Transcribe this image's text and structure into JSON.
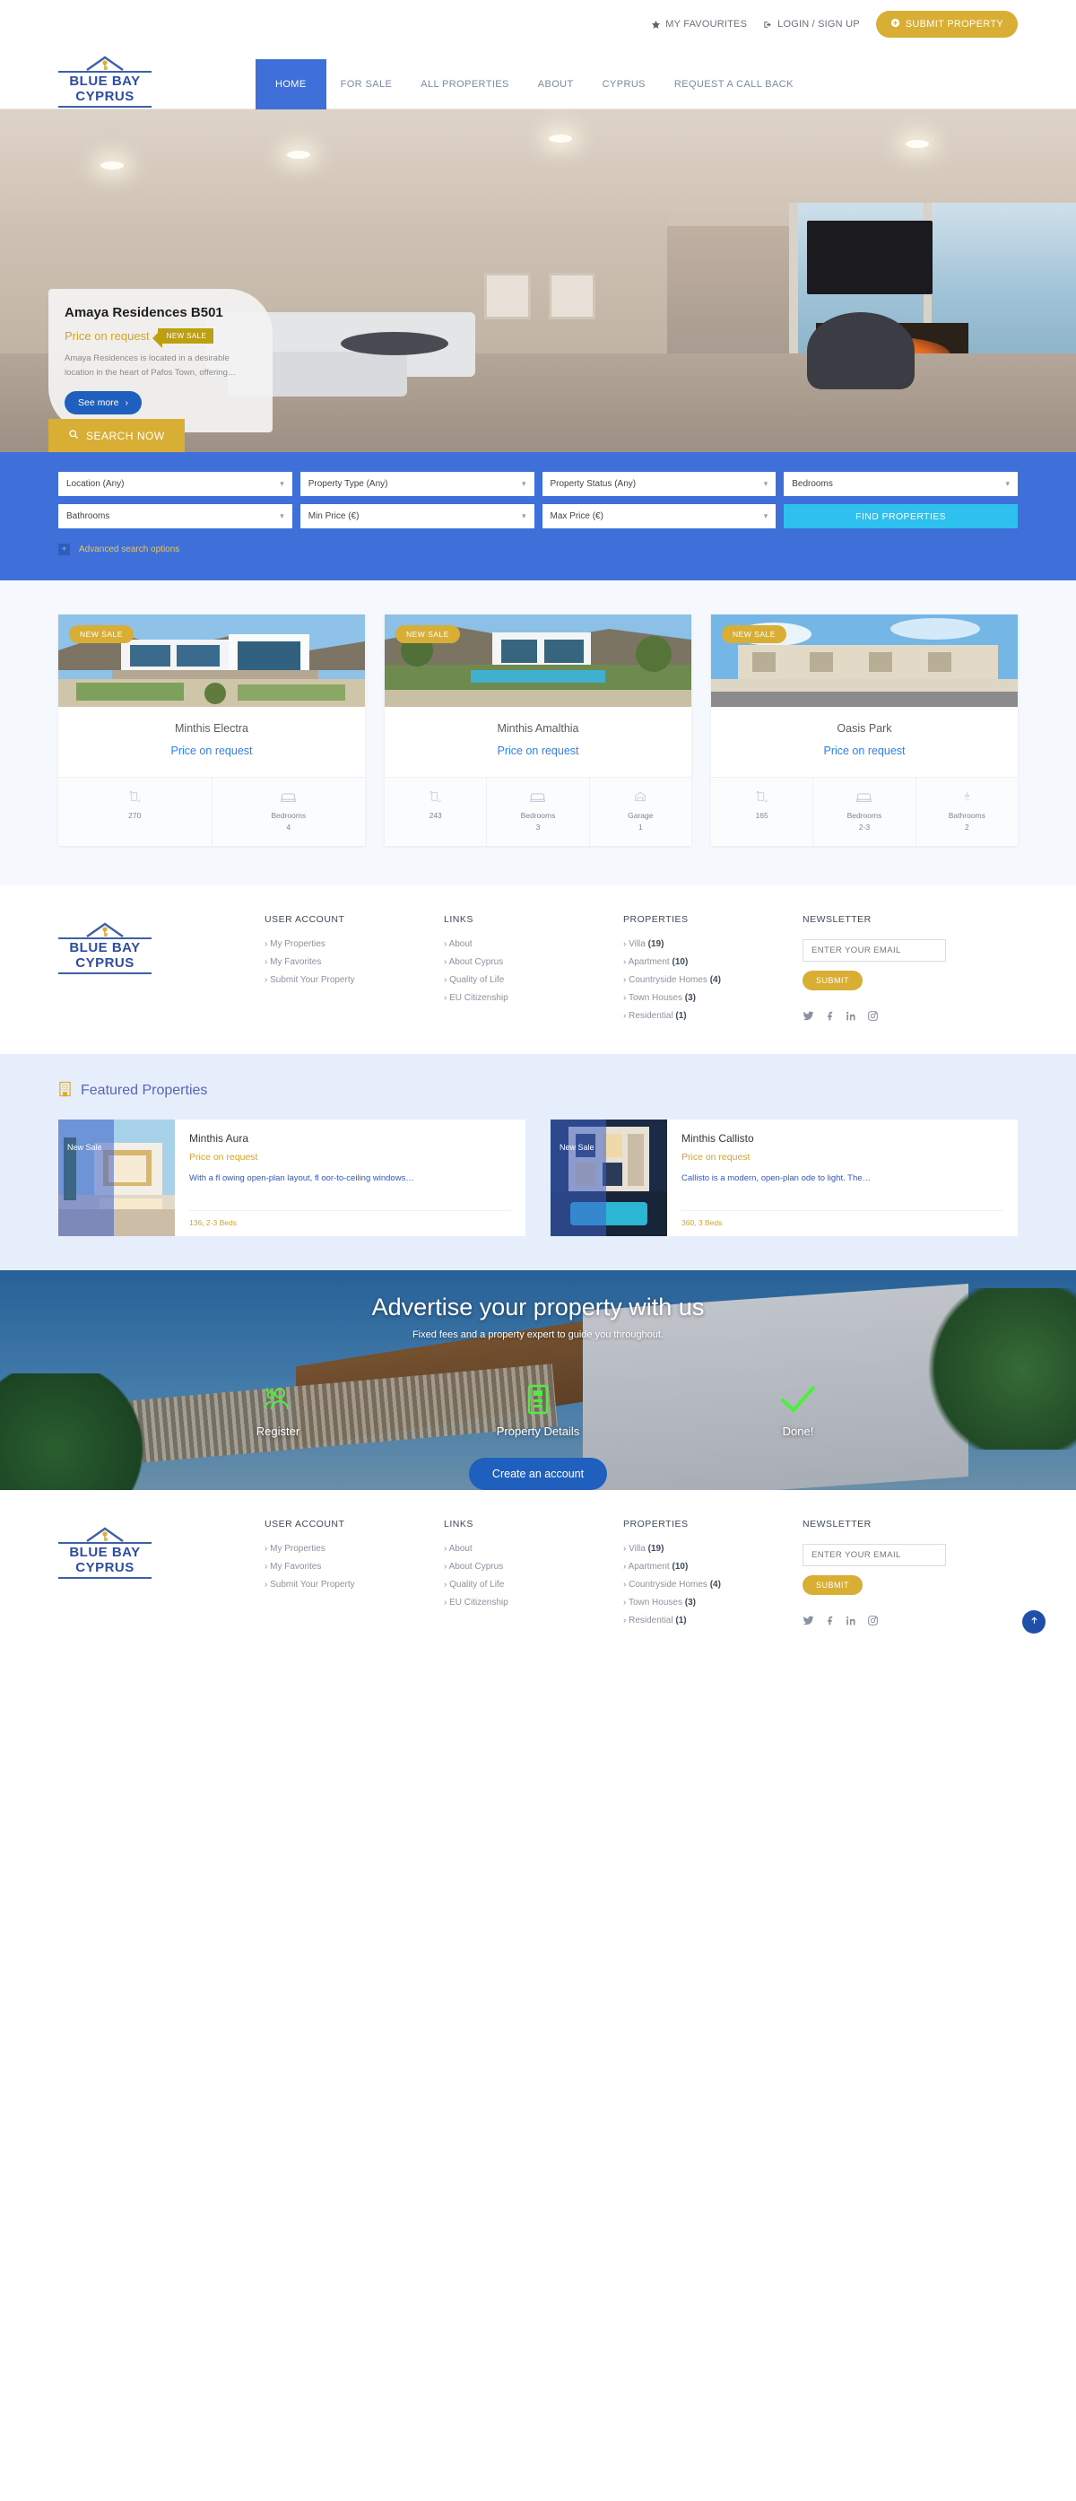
{
  "brand": {
    "name": "BLUE BAY CYPRUS"
  },
  "topbar": {
    "favourites": "MY FAVOURITES",
    "login": "LOGIN / SIGN UP",
    "submit": "SUBMIT PROPERTY"
  },
  "nav": {
    "items": [
      {
        "label": "HOME",
        "active": true
      },
      {
        "label": "FOR SALE",
        "active": false
      },
      {
        "label": "ALL PROPERTIES",
        "active": false
      },
      {
        "label": "ABOUT",
        "active": false
      },
      {
        "label": "CYPRUS",
        "active": false
      },
      {
        "label": "REQUEST A CALL BACK",
        "active": false
      }
    ]
  },
  "hero": {
    "card": {
      "title": "Amaya Residences B501",
      "price": "Price on request",
      "badge": "NEW SALE",
      "desc": "Amaya Residences is located in a desirable location in the heart of Pafos Town, offering…",
      "button": "See more"
    },
    "search_now": "SEARCH NOW"
  },
  "search": {
    "location": "Location (Any)",
    "property_type": "Property Type (Any)",
    "property_status": "Property Status (Any)",
    "bedrooms": "Bedrooms",
    "bathrooms": "Bathrooms",
    "min_price": "Min Price (€)",
    "max_price": "Max Price (€)",
    "find_button": "FIND PROPERTIES",
    "advanced": "Advanced search options",
    "plus": "+"
  },
  "properties": [
    {
      "badge": "NEW SALE",
      "name": "Minthis Electra",
      "price": "Price on request",
      "stats": [
        {
          "icon": "area-icon",
          "label": "",
          "value": "270"
        },
        {
          "icon": "bed-icon",
          "label": "Bedrooms",
          "value": "4"
        }
      ]
    },
    {
      "badge": "NEW SALE",
      "name": "Minthis Amalthia",
      "price": "Price on request",
      "stats": [
        {
          "icon": "area-icon",
          "label": "",
          "value": "243"
        },
        {
          "icon": "bed-icon",
          "label": "Bedrooms",
          "value": "3"
        },
        {
          "icon": "garage-icon",
          "label": "Garage",
          "value": "1"
        }
      ]
    },
    {
      "badge": "NEW SALE",
      "name": "Oasis Park",
      "price": "Price on request",
      "stats": [
        {
          "icon": "area-icon",
          "label": "",
          "value": "165"
        },
        {
          "icon": "bed-icon",
          "label": "Bedrooms",
          "value": "2-3"
        },
        {
          "icon": "bath-icon",
          "label": "Bathrooms",
          "value": "2"
        }
      ]
    }
  ],
  "footer": {
    "user_account": {
      "title": "USER ACCOUNT",
      "links": [
        "My Properties",
        "My Favorites",
        "Submit Your Property"
      ]
    },
    "links": {
      "title": "LINKS",
      "links": [
        "About",
        "About Cyprus",
        "Quality of Life",
        "EU Citizenship"
      ]
    },
    "properties": {
      "title": "PROPERTIES",
      "links": [
        {
          "label": "Villa",
          "count": "(19)"
        },
        {
          "label": "Apartment",
          "count": "(10)"
        },
        {
          "label": "Countryside Homes",
          "count": "(4)"
        },
        {
          "label": "Town Houses",
          "count": "(3)"
        },
        {
          "label": "Residential",
          "count": "(1)"
        }
      ]
    },
    "newsletter": {
      "title": "NEWSLETTER",
      "placeholder": "ENTER YOUR EMAIL",
      "submit": "SUBMIT"
    },
    "socials": [
      "twitter-icon",
      "facebook-icon",
      "linkedin-icon",
      "instagram-icon"
    ]
  },
  "featured": {
    "title": "Featured Properties",
    "cards": [
      {
        "badge": "New Sale",
        "name": "Minthis Aura",
        "price": "Price on request",
        "desc": "With a fl owing open-plan layout, fl oor-to-ceiling windows…",
        "area": "136",
        "beds": "2-3 Beds"
      },
      {
        "badge": "New Sale",
        "name": "Minthis Callisto",
        "price": "Price on request",
        "desc": "Callisto is a modern, open-plan ode to light. The…",
        "area": "360",
        "beds": "3 Beds"
      }
    ]
  },
  "cta": {
    "title": "Advertise your property with us",
    "subtitle": "Fixed fees and a property expert to guide you throughout.",
    "steps": [
      {
        "icon": "register-user-icon",
        "label": "Register"
      },
      {
        "icon": "property-details-icon",
        "label": "Property Details"
      },
      {
        "icon": "check-icon",
        "label": "Done!"
      }
    ],
    "button": "Create an account"
  },
  "colors": {
    "gold": "#d9ae35",
    "blue": "#3f6fd8",
    "cyan": "#2ec1ef",
    "link_blue": "#2f82e8",
    "deep_blue": "#1f5fbd"
  }
}
